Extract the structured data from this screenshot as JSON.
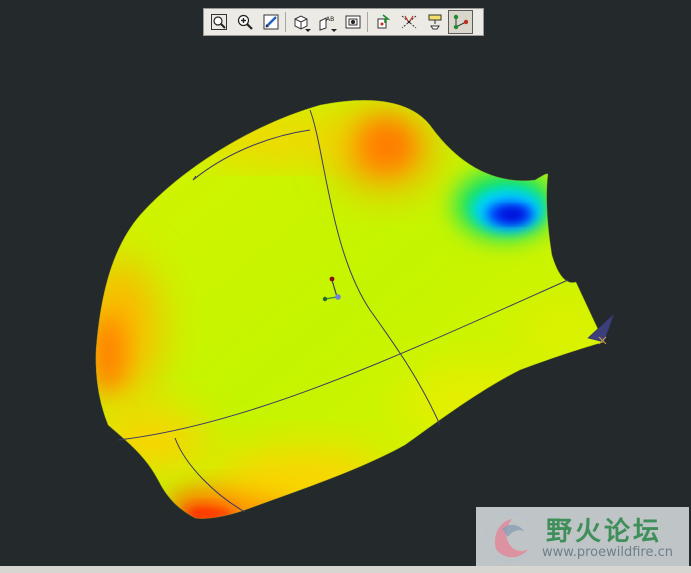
{
  "toolbar": {
    "buttons": [
      {
        "name": "refit",
        "icon": "zoom-fit-icon",
        "active": false
      },
      {
        "name": "zoom-in",
        "icon": "zoom-in-icon",
        "active": false
      },
      {
        "name": "repaint",
        "icon": "repaint-icon",
        "active": false
      },
      {
        "name": "display-style",
        "icon": "shaded-cube-icon",
        "active": false,
        "dropdown": true
      },
      {
        "name": "saved-views",
        "icon": "saved-orientation-icon",
        "active": false,
        "dropdown": true,
        "glyph_text": "AB"
      },
      {
        "name": "view-manager",
        "icon": "view-manager-icon",
        "active": false
      },
      {
        "name": "spin-center",
        "icon": "spin-center-icon",
        "active": false
      },
      {
        "name": "axis-display",
        "icon": "axis-display-icon",
        "active": false
      },
      {
        "name": "annotation-display",
        "icon": "annotation-display-icon",
        "active": false
      },
      {
        "name": "point-display",
        "icon": "point-display-icon",
        "active": true
      }
    ]
  },
  "colors": {
    "background": "#24292b",
    "surface_base": "#c6f400",
    "surface_warm": "#ffb000",
    "surface_hot": "#ff2a00",
    "surface_cool": "#00d8ff",
    "surface_cold": "#0018ff",
    "edge_lines": "#3a3a6a"
  },
  "watermark": {
    "title": "野火论坛",
    "url": "www.proewildfire.cn"
  }
}
